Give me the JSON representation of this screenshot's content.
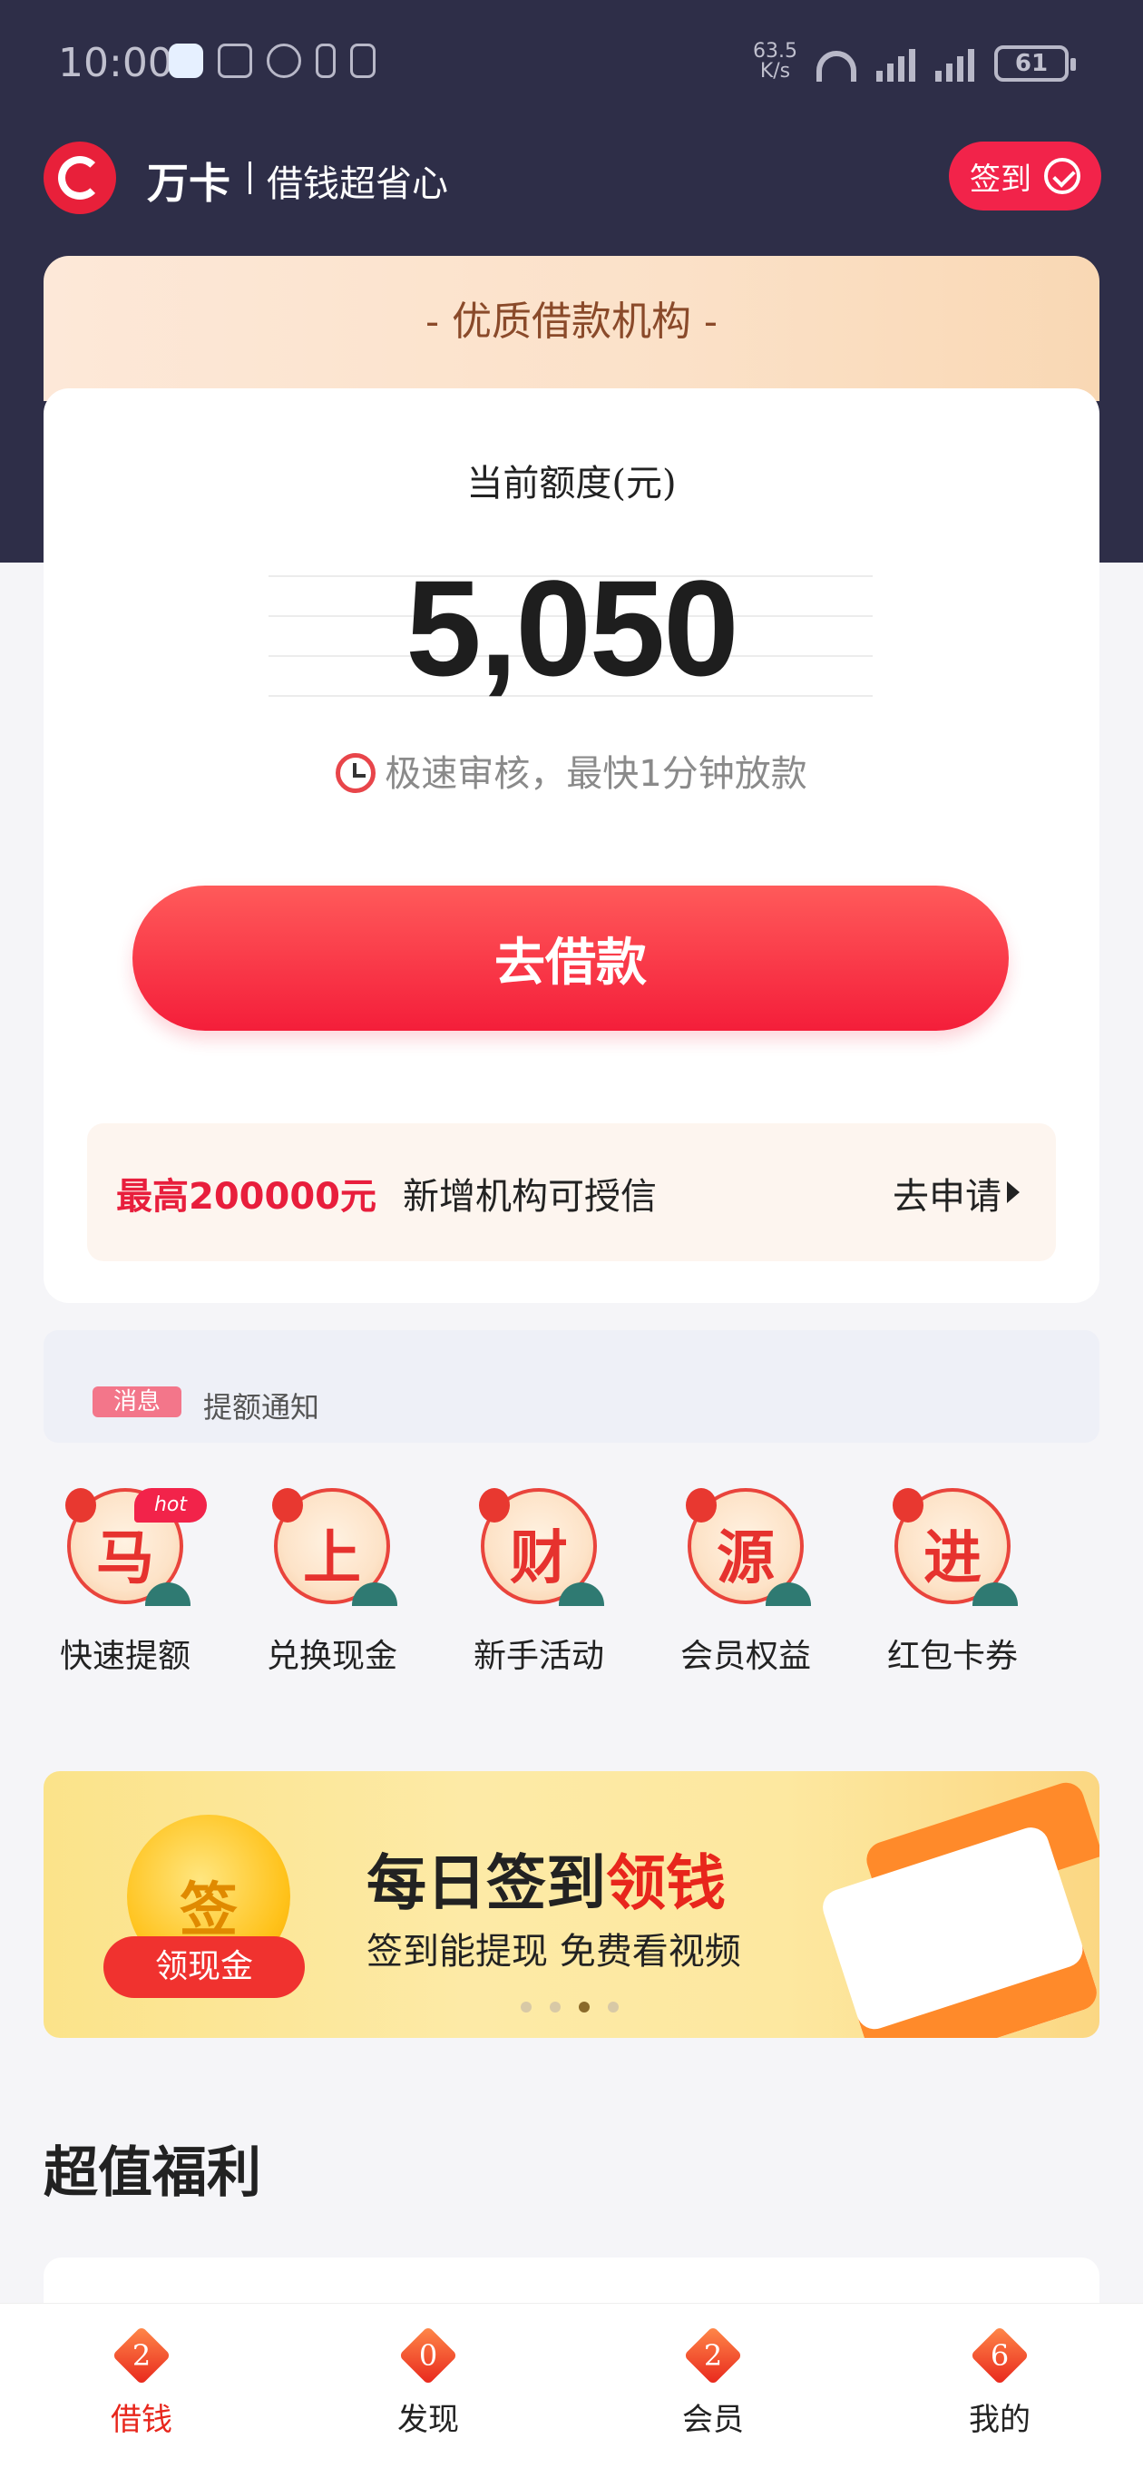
{
  "status_bar": {
    "time": "10:00",
    "net_speed_value": "63.5",
    "net_speed_unit": "K/s",
    "battery": "61"
  },
  "header": {
    "brand": "万卡",
    "slogan": "借钱超省心",
    "signin_label": "签到"
  },
  "credit_card": {
    "section_title": "- 优质借款机构 -",
    "label": "当前额度(元)",
    "amount": "5,050",
    "tagline": "极速审核，最快1分钟放款",
    "borrow_button": "去借款",
    "promo_highlight": "最高200000元",
    "promo_text": "新增机构可授信",
    "promo_action": "去申请"
  },
  "ticker": {
    "items": [
      {
        "tag": "消息",
        "text": "提额通知"
      }
    ]
  },
  "features": [
    {
      "char": "马",
      "label": "快速提额",
      "badge": "hot"
    },
    {
      "char": "上",
      "label": "兑换现金"
    },
    {
      "char": "财",
      "label": "新手活动"
    },
    {
      "char": "源",
      "label": "会员权益"
    },
    {
      "char": "进",
      "label": "红包卡券"
    }
  ],
  "banner": {
    "coin_char": "签",
    "coin_pill": "领现金",
    "title_main": "每日签到",
    "title_highlight": "领钱",
    "subtitle": "签到能提现 免费看视频",
    "slide_count": 4,
    "active_slide": 3
  },
  "section": {
    "title": "超值福利"
  },
  "bottom_nav": [
    {
      "num": "2",
      "label": "借钱",
      "active": true
    },
    {
      "num": "0",
      "label": "发现"
    },
    {
      "num": "2",
      "label": "会员"
    },
    {
      "num": "6",
      "label": "我的"
    }
  ],
  "colors": {
    "header_bg": "#2e2e48",
    "accent_red": "#f2234a",
    "button_red": "#f41e3a"
  }
}
